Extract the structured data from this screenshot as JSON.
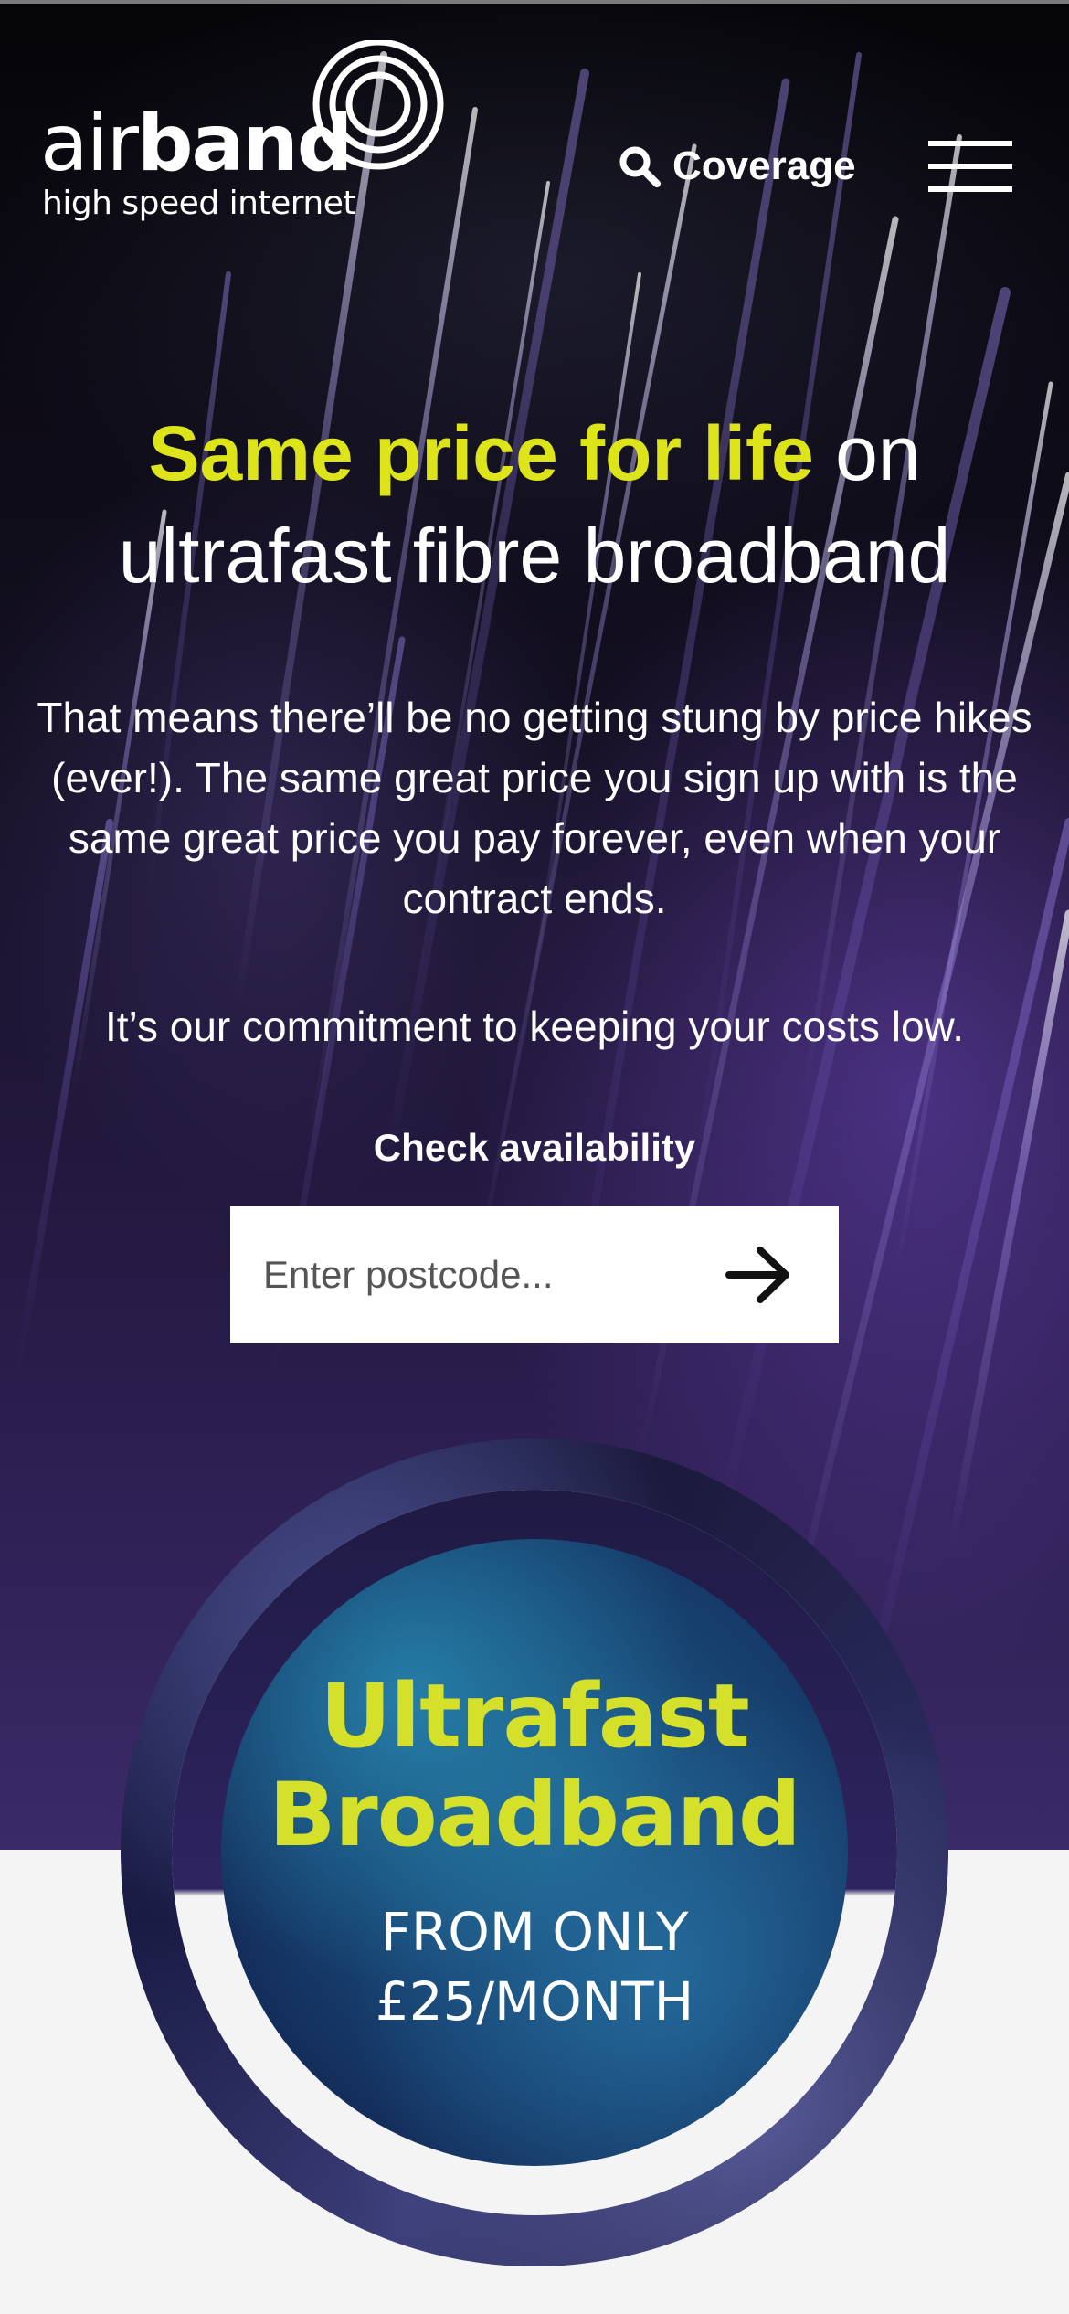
{
  "colors": {
    "accent": "#dde41a",
    "text": "#ffffff",
    "background_light": "#f4f4f4"
  },
  "brand": {
    "name_light": "air",
    "name_bold": "band",
    "tagline": "high speed internet"
  },
  "nav": {
    "coverage_label": "Coverage",
    "search_icon": "search-icon",
    "menu_icon": "hamburger-menu-icon"
  },
  "hero": {
    "headline_highlight": "Same price for life",
    "headline_rest_1": " on",
    "headline_rest_2": "ultrafast fibre broadband",
    "paragraph_1": "That means there’ll be no getting stung by price hikes (ever!). The same great price you sign up with is the same great price you pay forever, even when your contract ends.",
    "paragraph_2": "It’s our commitment to keeping your costs low."
  },
  "availability": {
    "label": "Check availability",
    "placeholder": "Enter postcode...",
    "value": "",
    "submit_icon": "arrow-right-icon"
  },
  "promo": {
    "title_line_1": "Ultrafast",
    "title_line_2": "Broadband",
    "sub_line_1": "FROM ONLY",
    "sub_line_2": "£25/MONTH"
  }
}
